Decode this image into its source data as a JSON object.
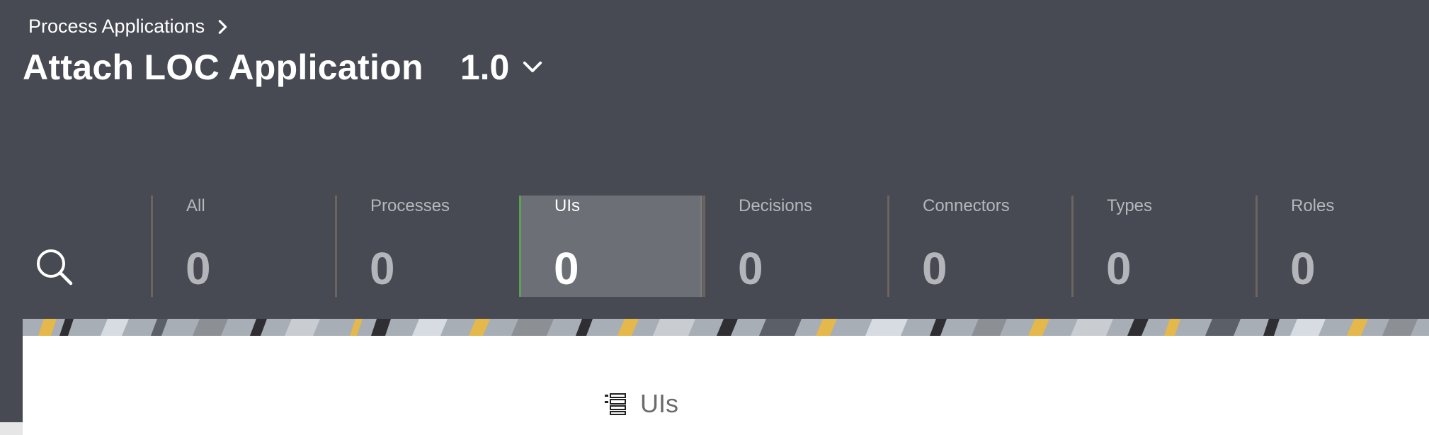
{
  "breadcrumb": {
    "label": "Process Applications"
  },
  "header": {
    "title": "Attach LOC Application",
    "version": "1.0"
  },
  "tabs": [
    {
      "label": "All",
      "count": "0"
    },
    {
      "label": "Processes",
      "count": "0"
    },
    {
      "label": "UIs",
      "count": "0",
      "active": true
    },
    {
      "label": "Decisions",
      "count": "0"
    },
    {
      "label": "Connectors",
      "count": "0"
    },
    {
      "label": "Types",
      "count": "0"
    },
    {
      "label": "Roles",
      "count": "0"
    }
  ],
  "panel": {
    "heading": "UIs",
    "icon": "list-icon"
  },
  "icons": {
    "search": "search-icon",
    "breadcrumb_chevron": "chevron-right-icon",
    "version_chevron": "chevron-down-icon"
  },
  "colors": {
    "header_bg": "#474a52",
    "active_tab_bg": "#6c6f76",
    "active_accent": "#5aa154"
  }
}
